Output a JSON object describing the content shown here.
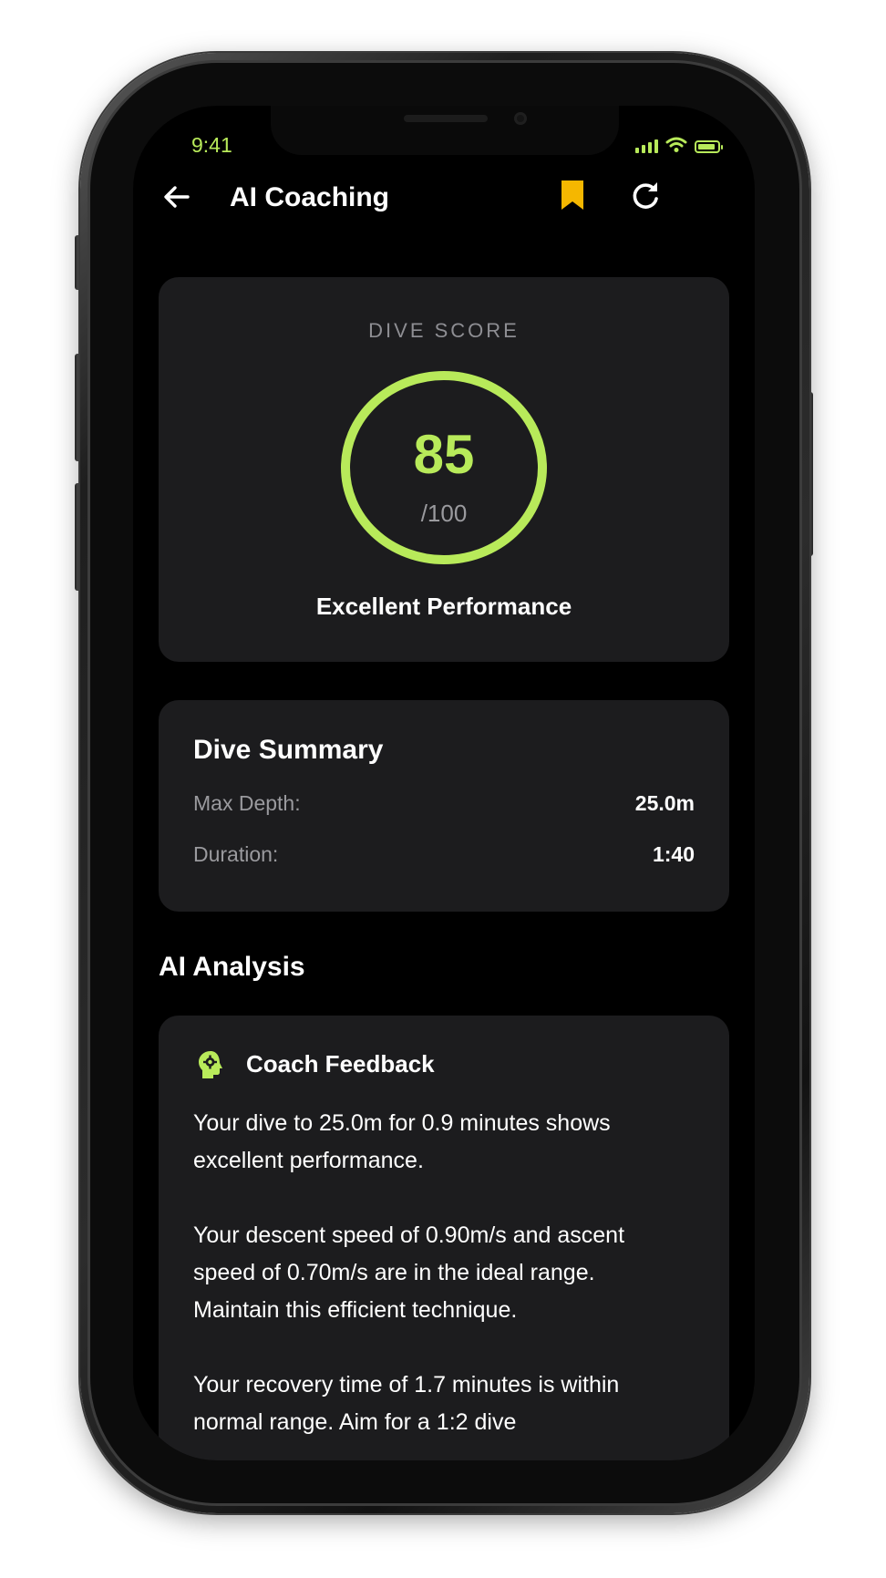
{
  "status_bar": {
    "time": "9:41",
    "accent_color": "#b8ea5a"
  },
  "nav": {
    "title": "AI Coaching",
    "back_icon": "arrow-left-icon",
    "bookmark_icon": "bookmark-icon",
    "bookmark_color": "#f5b700",
    "refresh_icon": "refresh-icon"
  },
  "score": {
    "label": "DIVE SCORE",
    "value": "85",
    "max": "/100",
    "rating": "Excellent Performance",
    "ring_color": "#b8ea5a"
  },
  "summary": {
    "title": "Dive Summary",
    "rows": [
      {
        "label": "Max Depth:",
        "value": "25.0m"
      },
      {
        "label": "Duration:",
        "value": "1:40"
      }
    ]
  },
  "analysis": {
    "section_title": "AI Analysis",
    "card_title": "Coach Feedback",
    "icon": "brain-gear-icon",
    "paragraphs": [
      "Your dive to 25.0m for 0.9 minutes shows excellent performance.",
      "Your descent speed of 0.90m/s and ascent speed of 0.70m/s are in the ideal range. Maintain this efficient technique.",
      "Your recovery time of 1.7 minutes is within normal range. Aim for a 1:2 dive"
    ]
  }
}
